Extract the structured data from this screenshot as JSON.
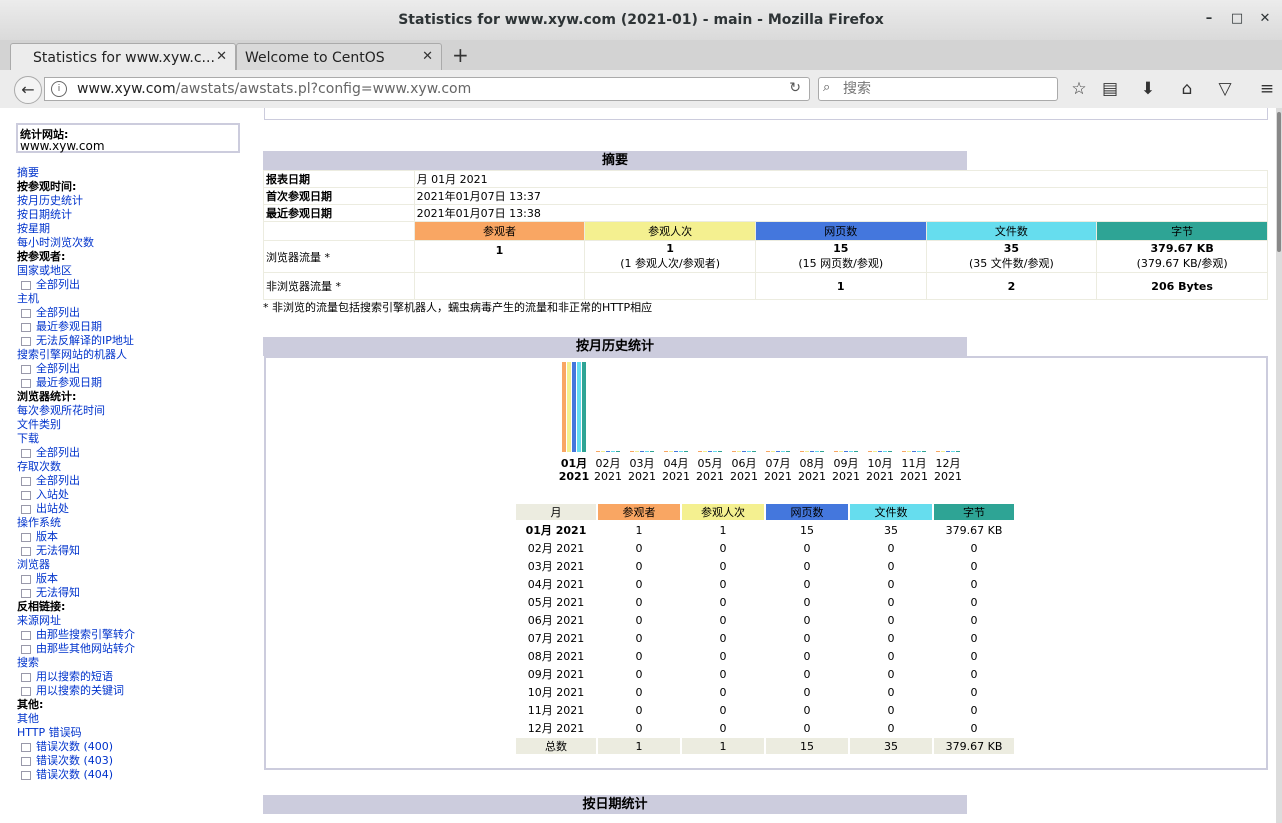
{
  "window": {
    "title": "Statistics for www.xyw.com (2021-01) - main - Mozilla Firefox",
    "minimize": "–",
    "maximize": "□",
    "close": "✕"
  },
  "tabs": [
    {
      "label": "Statistics for www.xyw.c...",
      "close": "✕"
    },
    {
      "label": "Welcome to CentOS",
      "close": "✕"
    }
  ],
  "newtab": "+",
  "nav": {
    "url_host": "www.xyw.com",
    "url_rest": "/awstats/awstats.pl?config=www.xyw.com",
    "search_placeholder": "搜索"
  },
  "site_box": {
    "label": "统计网站:",
    "site": "www.xyw.com"
  },
  "menu": [
    {
      "t": "lnk",
      "label": "摘要"
    },
    {
      "t": "sec",
      "label": "按参观时间:"
    },
    {
      "t": "lnk",
      "label": "按月历史统计"
    },
    {
      "t": "lnk",
      "label": "按日期统计"
    },
    {
      "t": "lnk",
      "label": "按星期"
    },
    {
      "t": "lnk",
      "label": "每小时浏览次数"
    },
    {
      "t": "sec",
      "label": "按参观者:"
    },
    {
      "t": "lnk",
      "label": "国家或地区"
    },
    {
      "t": "sub",
      "label": "全部列出"
    },
    {
      "t": "lnk",
      "label": "主机"
    },
    {
      "t": "sub",
      "label": "全部列出"
    },
    {
      "t": "sub",
      "label": "最近参观日期"
    },
    {
      "t": "sub",
      "label": "无法反解译的IP地址"
    },
    {
      "t": "lnk",
      "label": "搜索引擎网站的机器人"
    },
    {
      "t": "sub",
      "label": "全部列出"
    },
    {
      "t": "sub",
      "label": "最近参观日期"
    },
    {
      "t": "sec",
      "label": "浏览器统计:"
    },
    {
      "t": "lnk",
      "label": "每次参观所花时间"
    },
    {
      "t": "lnk",
      "label": "文件类别"
    },
    {
      "t": "lnk",
      "label": "下载"
    },
    {
      "t": "sub",
      "label": "全部列出"
    },
    {
      "t": "lnk",
      "label": "存取次数"
    },
    {
      "t": "sub",
      "label": "全部列出"
    },
    {
      "t": "sub",
      "label": "入站处"
    },
    {
      "t": "sub",
      "label": "出站处"
    },
    {
      "t": "lnk",
      "label": "操作系统"
    },
    {
      "t": "sub",
      "label": "版本"
    },
    {
      "t": "sub",
      "label": "无法得知"
    },
    {
      "t": "lnk",
      "label": "浏览器"
    },
    {
      "t": "sub",
      "label": "版本"
    },
    {
      "t": "sub",
      "label": "无法得知"
    },
    {
      "t": "sec",
      "label": "反相链接:"
    },
    {
      "t": "lnk",
      "label": "来源网址"
    },
    {
      "t": "sub",
      "label": "由那些搜索引擎转介"
    },
    {
      "t": "sub",
      "label": "由那些其他网站转介"
    },
    {
      "t": "lnk",
      "label": "搜索"
    },
    {
      "t": "sub",
      "label": "用以搜索的短语"
    },
    {
      "t": "sub",
      "label": "用以搜索的关键词"
    },
    {
      "t": "sec",
      "label": "其他:"
    },
    {
      "t": "lnk",
      "label": "其他"
    },
    {
      "t": "lnk",
      "label": "HTTP 错误码"
    },
    {
      "t": "sub",
      "label": "错误次数 (400)"
    },
    {
      "t": "sub",
      "label": "错误次数 (403)"
    },
    {
      "t": "sub",
      "label": "错误次数 (404)"
    }
  ],
  "summary": {
    "title": "摘要",
    "period_label": "报表日期",
    "period_value": "月 01月 2021",
    "first_label": "首次参观日期",
    "first_value": "2021年01月07日 13:37",
    "last_label": "最近参观日期",
    "last_value": "2021年01月07日 13:38",
    "headers": [
      "参观者",
      "参观人次",
      "网页数",
      "文件数",
      "字节"
    ],
    "viewed_label": "浏览器流量 *",
    "viewed": [
      {
        "main": "1",
        "sub": ""
      },
      {
        "main": "1",
        "sub": "(1 参观人次/参观者)"
      },
      {
        "main": "15",
        "sub": "(15 网页数/参观)"
      },
      {
        "main": "35",
        "sub": "(35 文件数/参观)"
      },
      {
        "main": "379.67 KB",
        "sub": "(379.67 KB/参观)"
      }
    ],
    "notviewed_label": "非浏览器流量 *",
    "notviewed": [
      "",
      "",
      "1",
      "2",
      "206 Bytes"
    ],
    "note": "* 非浏览的流量包括搜索引擎机器人，蠕虫病毒产生的流量和非正常的HTTP相应"
  },
  "monthly": {
    "title": "按月历史统计",
    "col_headers": [
      "月",
      "参观者",
      "参观人次",
      "网页数",
      "文件数",
      "字节"
    ],
    "rows": [
      [
        "01月 2021",
        "1",
        "1",
        "15",
        "35",
        "379.67 KB"
      ],
      [
        "02月 2021",
        "0",
        "0",
        "0",
        "0",
        "0"
      ],
      [
        "03月 2021",
        "0",
        "0",
        "0",
        "0",
        "0"
      ],
      [
        "04月 2021",
        "0",
        "0",
        "0",
        "0",
        "0"
      ],
      [
        "05月 2021",
        "0",
        "0",
        "0",
        "0",
        "0"
      ],
      [
        "06月 2021",
        "0",
        "0",
        "0",
        "0",
        "0"
      ],
      [
        "07月 2021",
        "0",
        "0",
        "0",
        "0",
        "0"
      ],
      [
        "08月 2021",
        "0",
        "0",
        "0",
        "0",
        "0"
      ],
      [
        "09月 2021",
        "0",
        "0",
        "0",
        "0",
        "0"
      ],
      [
        "10月 2021",
        "0",
        "0",
        "0",
        "0",
        "0"
      ],
      [
        "11月 2021",
        "0",
        "0",
        "0",
        "0",
        "0"
      ],
      [
        "12月 2021",
        "0",
        "0",
        "0",
        "0",
        "0"
      ]
    ],
    "total": [
      "总数",
      "1",
      "1",
      "15",
      "35",
      "379.67 KB"
    ]
  },
  "chart_data": {
    "type": "bar",
    "categories": [
      "01月 2021",
      "02月 2021",
      "03月 2021",
      "04月 2021",
      "05月 2021",
      "06月 2021",
      "07月 2021",
      "08月 2021",
      "09月 2021",
      "10月 2021",
      "11月 2021",
      "12月 2021"
    ],
    "month_labels": [
      "01月",
      "02月",
      "03月",
      "04月",
      "05月",
      "06月",
      "07月",
      "08月",
      "09月",
      "10月",
      "11月",
      "12月"
    ],
    "year_label": "2021",
    "series": [
      {
        "name": "参观者",
        "color": "#f9a663",
        "values": [
          1,
          0,
          0,
          0,
          0,
          0,
          0,
          0,
          0,
          0,
          0,
          0
        ]
      },
      {
        "name": "参观人次",
        "color": "#f4f090",
        "values": [
          1,
          0,
          0,
          0,
          0,
          0,
          0,
          0,
          0,
          0,
          0,
          0
        ]
      },
      {
        "name": "网页数",
        "color": "#4477dd",
        "values": [
          15,
          0,
          0,
          0,
          0,
          0,
          0,
          0,
          0,
          0,
          0,
          0
        ]
      },
      {
        "name": "文件数",
        "color": "#66ddee",
        "values": [
          35,
          0,
          0,
          0,
          0,
          0,
          0,
          0,
          0,
          0,
          0,
          0
        ]
      },
      {
        "name": "字节",
        "color": "#2ea495",
        "values": [
          379.67,
          0,
          0,
          0,
          0,
          0,
          0,
          0,
          0,
          0,
          0,
          0
        ]
      }
    ]
  },
  "daily": {
    "title": "按日期统计"
  },
  "colors": {
    "visitors": "#f9a663",
    "visits": "#f4f090",
    "pages": "#4477dd",
    "files": "#66ddee",
    "bytes": "#2ea495",
    "header_bg": "#ccccdd",
    "link": "#0033cc"
  }
}
